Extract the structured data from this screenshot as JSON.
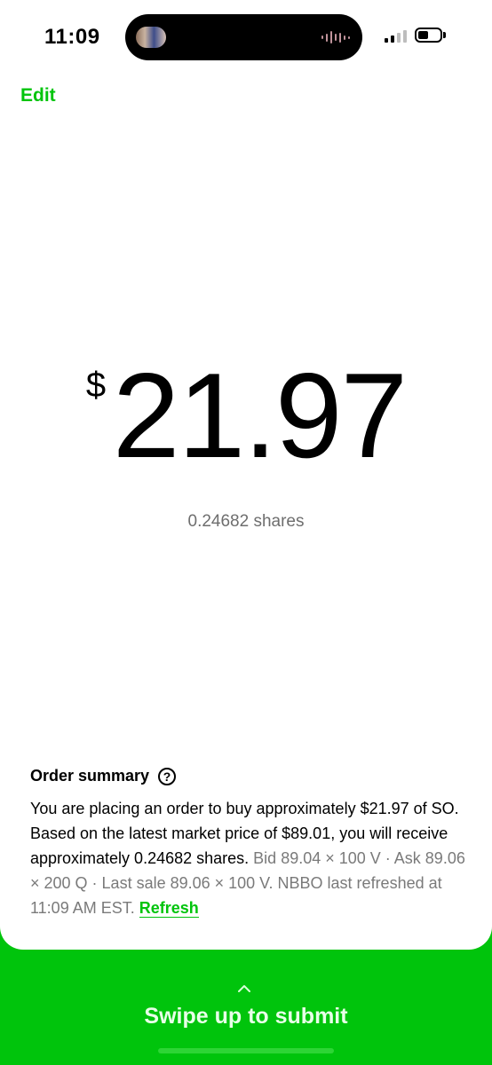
{
  "status_bar": {
    "time": "11:09"
  },
  "header": {
    "edit_label": "Edit"
  },
  "order": {
    "currency_symbol": "$",
    "amount": "21.97",
    "shares_text": "0.24682 shares"
  },
  "summary": {
    "title": "Order summary",
    "help_glyph": "?",
    "body_main": "You are placing an order to buy approximately $21.97 of SO. Based on the latest market price of $89.01, you will receive approximately 0.24682 shares.",
    "body_quote": "Bid 89.04 × 100 V · Ask 89.06 × 200 Q · Last sale 89.06 × 100 V. NBBO last refreshed at 11:09 AM EST.",
    "refresh_label": "Refresh"
  },
  "footer": {
    "swipe_label": "Swipe up to submit"
  },
  "colors": {
    "accent": "#00c40c",
    "muted_text": "#6e6e6e",
    "background": "#ffffff"
  },
  "icons": {
    "help": "question-circle-icon",
    "chevron": "chevron-up-icon"
  }
}
